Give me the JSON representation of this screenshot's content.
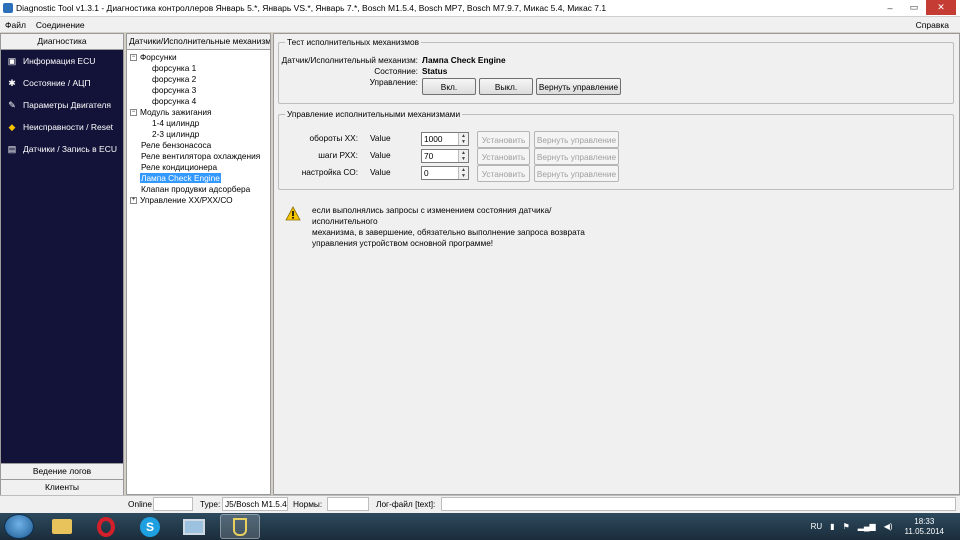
{
  "window": {
    "title": "Diagnostic Tool v1.3.1 - Диагностика контроллеров Январь 5.*, Январь VS.*, Январь 7.*, Bosch M1.5.4, Bosch MP7, Bosch M7.9.7, Микас 5.4, Микас 7.1"
  },
  "menu": {
    "file": "Файл",
    "connection": "Соединение",
    "help": "Справка"
  },
  "leftnav": {
    "header": "Диагностика",
    "items": [
      {
        "label": "Информация ECU",
        "icon": "monitor-icon"
      },
      {
        "label": "Состояние / АЦП",
        "icon": "gear-icon"
      },
      {
        "label": "Параметры Двигателя",
        "icon": "wrench-icon"
      },
      {
        "label": "Неисправности / Reset",
        "icon": "warning-engine-icon"
      },
      {
        "label": "Датчики / Запись в ECU",
        "icon": "sensor-icon"
      }
    ],
    "bottom1": "Ведение логов",
    "bottom2": "Клиенты"
  },
  "tree": {
    "header": "Датчики/Исполнительные механизмы",
    "nodes": [
      "Форсунки",
      "форсунка 1",
      "форсунка 2",
      "форсунка 3",
      "форсунка 4",
      "Модуль зажигания",
      "1-4 цилиндр",
      "2-3 цилиндр",
      "Реле бензонасоса",
      "Реле вентилятора охлаждения",
      "Реле кондиционера",
      "Лампа Check Engine",
      "Клапан продувки адсорбера",
      "Управление ХХ/РХХ/СО"
    ],
    "expand_minus": "−",
    "expand_plus": "+"
  },
  "test_group": {
    "title": "Тест исполнительных механизмов",
    "sensor_label": "Датчик/Исполнительный механизм:",
    "sensor_value": "Лампа Check Engine",
    "state_label": "Состояние:",
    "state_value": "Status",
    "control_label": "Управление:",
    "btn_on": "Вкл.",
    "btn_off": "Выкл.",
    "btn_return": "Вернуть управление"
  },
  "control_group": {
    "title": "Управление исполнительными механизмами",
    "rows": [
      {
        "label": "обороты ХХ:",
        "value_label": "Value",
        "value": "1000",
        "set": "Установить",
        "return": "Вернуть управление"
      },
      {
        "label": "шаги РХХ:",
        "value_label": "Value",
        "value": "70",
        "set": "Установить",
        "return": "Вернуть управление"
      },
      {
        "label": "настройка СО:",
        "value_label": "Value",
        "value": "0",
        "set": "Установить",
        "return": "Вернуть управление"
      }
    ]
  },
  "warning": {
    "line1": "если выполнялись запросы с изменением состояния датчика/исполнительного",
    "line2": "механизма, в завершение, обязательно выполнение запроса возврата",
    "line3": "управления устройством основной программе!"
  },
  "statusbar": {
    "online": "Online",
    "type_label": "Type:",
    "type_value": "J5/Bosch M1.5.4",
    "norms": "Нормы:",
    "log": "Лог-файл [text]:"
  },
  "taskbar": {
    "lang": "RU",
    "time": "18:33",
    "date": "11.05.2014"
  },
  "colors": {
    "nav_bg": "#13133a",
    "selection": "#3399ff",
    "warning": "#f5c400"
  }
}
